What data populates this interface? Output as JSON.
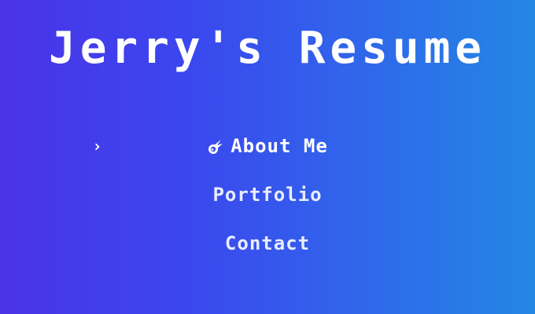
{
  "page": {
    "title": "Jerry's Resume"
  },
  "menu": {
    "cursor_glyph": "›",
    "items": [
      {
        "label": "About Me",
        "icon": "meteor-icon",
        "selected": true
      },
      {
        "label": "Portfolio",
        "selected": false
      },
      {
        "label": "Contact",
        "selected": false
      }
    ]
  },
  "colors": {
    "background_start": "#4a33e8",
    "background_end": "#2387e4",
    "text": "#ffffff"
  }
}
